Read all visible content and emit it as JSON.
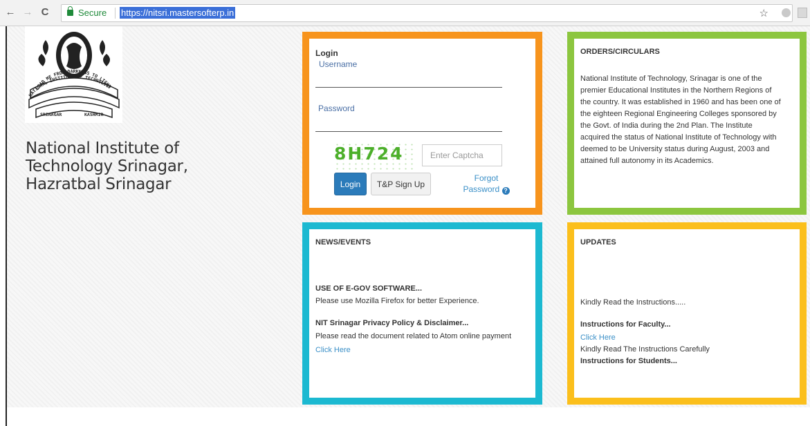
{
  "browser": {
    "back": "←",
    "forward": "→",
    "reload": "C",
    "secure_label": "Secure",
    "url": "https://nitsri.mastersofterp.in",
    "star": "☆"
  },
  "institute": {
    "name_line1": "National Institute of",
    "name_line2": "Technology Srinagar,",
    "name_line3": "Hazratbal Srinagar",
    "logo_text": {
      "motto_top": "LEAD ME FROM DARKNESS TO LIGHT",
      "ring": "NATIONAL INSTITUTE OF TECHNOLOGY",
      "city_left": "SRINAGAR",
      "city_right": "KASHMIR"
    }
  },
  "login": {
    "heading": "Login",
    "username_label": "Username",
    "password_label": "Password",
    "captcha_text": "8H724",
    "captcha_placeholder": "Enter Captcha",
    "login_button": "Login",
    "signup_button": "T&P Sign Up",
    "forgot_line1": "Forgot",
    "forgot_line2": "Password"
  },
  "orders": {
    "title": "ORDERS/CIRCULARS",
    "lines": [
      "National Institute of Technology, Srinagar is one of the",
      "premier Educational Institutes in the Northern Regions of",
      "the country. It was established in 1960 and has been one of",
      "the eighteen Regional Engineering Colleges sponsored by",
      "the Govt. of India during the 2nd Plan. The Institute",
      "acquired the status of National Institute of Technology with",
      "deemed to be University status during August, 2003 and",
      "attained full autonomy in its Academics."
    ]
  },
  "news": {
    "title": "NEWS/EVENTS",
    "item1_title": "USE OF E-GOV SOFTWARE...",
    "item1_text": "Please use Mozilla Firefox for better Experience.",
    "item2_title": "NIT Srinagar Privacy Policy & Disclaimer...",
    "item2_text": "Please read the document related to Atom online payment",
    "item2_link": "Click Here"
  },
  "updates": {
    "title": "UPDATES",
    "intro": "Kindly Read the Instructions.....",
    "faculty_title": "Instructions for Faculty...",
    "faculty_link": "Click Here",
    "faculty_text": "Kindly Read The Instructions Carefully",
    "students_title": "Instructions for Students..."
  },
  "colors": {
    "login_border": "#f7941d",
    "orders_border": "#8cc63f",
    "news_border": "#1cb9d1",
    "updates_border": "#fbbf1c",
    "link": "#3a8fc7",
    "button_primary": "#2b7bba"
  }
}
